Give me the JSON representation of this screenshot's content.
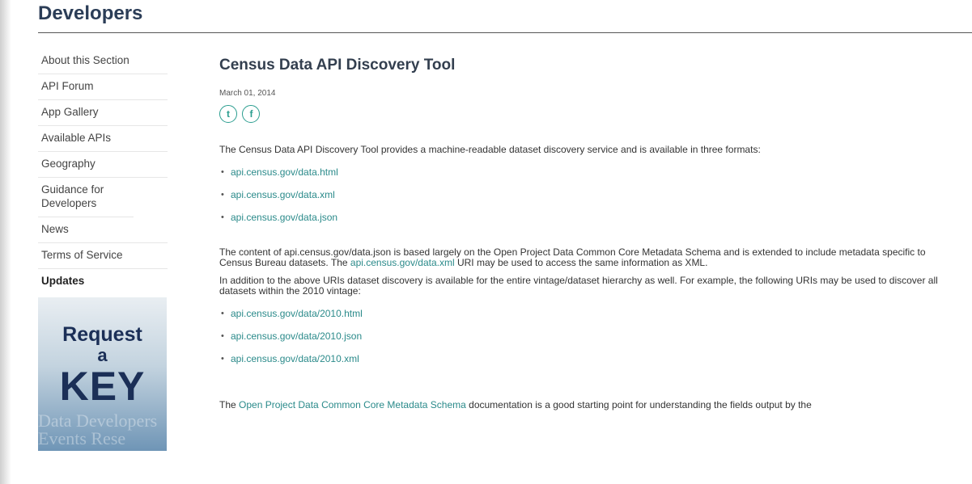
{
  "header": {
    "title": "Developers"
  },
  "sidebar": {
    "items": [
      {
        "label": "About this Section"
      },
      {
        "label": "API Forum"
      },
      {
        "label": "App Gallery"
      },
      {
        "label": "Available APIs"
      },
      {
        "label": "Geography"
      },
      {
        "label": "Guidance for Developers"
      },
      {
        "label": "News"
      },
      {
        "label": "Terms of Service"
      },
      {
        "label": "Updates"
      }
    ],
    "promo": {
      "line1": "Request",
      "line2": "a",
      "line3": "KEY",
      "faint_text": "Data Developers Events Rese"
    }
  },
  "main": {
    "title": "Census Data API Discovery Tool",
    "date": "March 01, 2014",
    "share": {
      "twitter_glyph": "t",
      "facebook_glyph": "f"
    },
    "intro": "The Census Data API Discovery Tool provides a machine-readable dataset discovery service and is available in three formats:",
    "format_links": [
      "api.census.gov/data.html",
      "api.census.gov/data.xml",
      "api.census.gov/data.json"
    ],
    "content_para": {
      "before": "The content of api.census.gov/data.json is based largely on the Open Project Data Common Core Metadata Schema and is extended to include metadata specific to Census Bureau datasets. The ",
      "link": "api.census.gov/data.xml",
      "after": " URI may be used to access the same information as XML."
    },
    "vintage_para": "In addition to the above URIs dataset discovery is available for the entire vintage/dataset hierarchy as well. For example, the following URIs may be used to discover all datasets within the 2010 vintage:",
    "vintage_links": [
      "api.census.gov/data/2010.html",
      "api.census.gov/data/2010.json",
      "api.census.gov/data/2010.xml"
    ],
    "schema_para": {
      "before": "The ",
      "link": "Open Project Data Common Core Metadata Schema",
      "after": " documentation is a good starting point for understanding the fields output by the"
    }
  },
  "colors": {
    "link": "#2a8a8a",
    "header": "#2b3d57",
    "promo_text": "#1b2f57"
  }
}
